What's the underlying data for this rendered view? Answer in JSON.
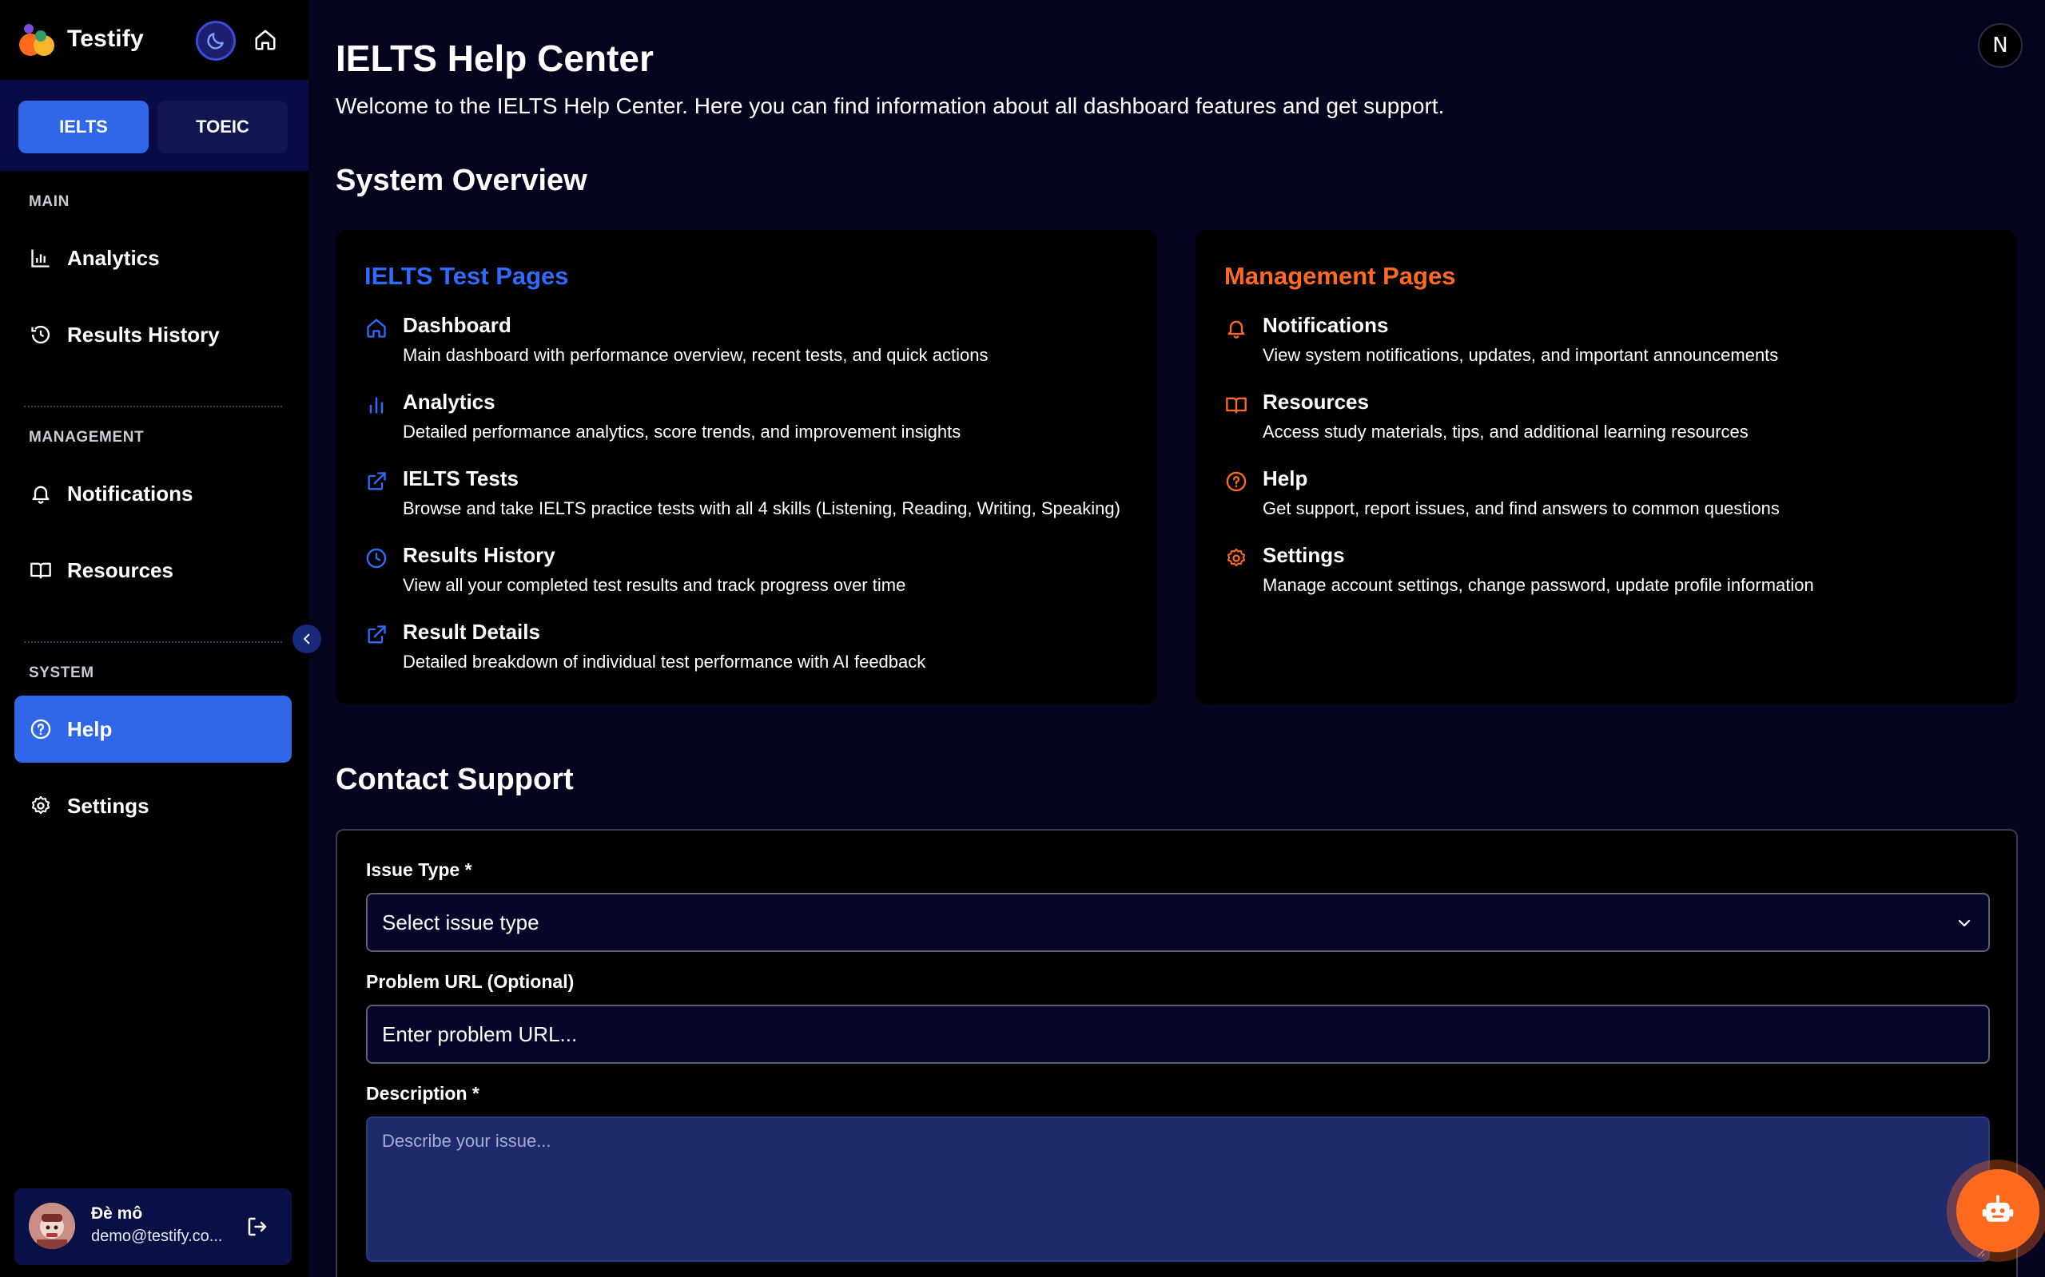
{
  "app": {
    "name": "Testify",
    "icons": {
      "logo": "testify-logo",
      "theme": "moon-icon",
      "home": "home-icon"
    }
  },
  "exam_tabs": [
    {
      "label": "IELTS",
      "active": true
    },
    {
      "label": "TOEIC",
      "active": false
    }
  ],
  "sidebar": {
    "sections": {
      "main": "MAIN",
      "management": "MANAGEMENT",
      "system": "SYSTEM"
    },
    "items": {
      "analytics": {
        "label": "Analytics",
        "icon": "bar-chart-icon"
      },
      "results_history": {
        "label": "Results History",
        "icon": "history-icon"
      },
      "notifications": {
        "label": "Notifications",
        "icon": "bell-icon"
      },
      "resources": {
        "label": "Resources",
        "icon": "book-icon"
      },
      "help": {
        "label": "Help",
        "icon": "help-circle-icon",
        "active": true
      },
      "settings": {
        "label": "Settings",
        "icon": "gear-icon"
      }
    },
    "user": {
      "name": "Đè mô",
      "email": "demo@testify.co..."
    }
  },
  "profile_initial": "N",
  "page": {
    "title": "IELTS Help Center",
    "subtitle": "Welcome to the IELTS Help Center. Here you can find information about all dashboard features and get support."
  },
  "overview": {
    "heading": "System Overview",
    "test_pages": {
      "title": "IELTS Test Pages",
      "color": "#2f6bff",
      "items": [
        {
          "title": "Dashboard",
          "desc": "Main dashboard with performance overview, recent tests, and quick actions",
          "icon": "home-icon"
        },
        {
          "title": "Analytics",
          "desc": "Detailed performance analytics, score trends, and improvement insights",
          "icon": "bar-chart-icon"
        },
        {
          "title": "IELTS Tests",
          "desc": "Browse and take IELTS practice tests with all 4 skills (Listening, Reading, Writing, Speaking)",
          "icon": "external-link-icon"
        },
        {
          "title": "Results History",
          "desc": "View all your completed test results and track progress over time",
          "icon": "clock-icon"
        },
        {
          "title": "Result Details",
          "desc": "Detailed breakdown of individual test performance with AI feedback",
          "icon": "external-link-icon"
        }
      ]
    },
    "management_pages": {
      "title": "Management Pages",
      "color": "#ff6a1f",
      "items": [
        {
          "title": "Notifications",
          "desc": "View system notifications, updates, and important announcements",
          "icon": "bell-icon"
        },
        {
          "title": "Resources",
          "desc": "Access study materials, tips, and additional learning resources",
          "icon": "book-icon"
        },
        {
          "title": "Help",
          "desc": "Get support, report issues, and find answers to common questions",
          "icon": "help-circle-icon"
        },
        {
          "title": "Settings",
          "desc": "Manage account settings, change password, update profile information",
          "icon": "gear-icon"
        }
      ]
    }
  },
  "contact": {
    "heading": "Contact Support",
    "issue_type": {
      "label": "Issue Type *",
      "value": "Select issue type"
    },
    "problem_url": {
      "label": "Problem URL (Optional)",
      "placeholder": "Enter problem URL..."
    },
    "description": {
      "label": "Description *",
      "placeholder": "Describe your issue..."
    }
  },
  "chatbot": {
    "icon": "robot-icon"
  }
}
